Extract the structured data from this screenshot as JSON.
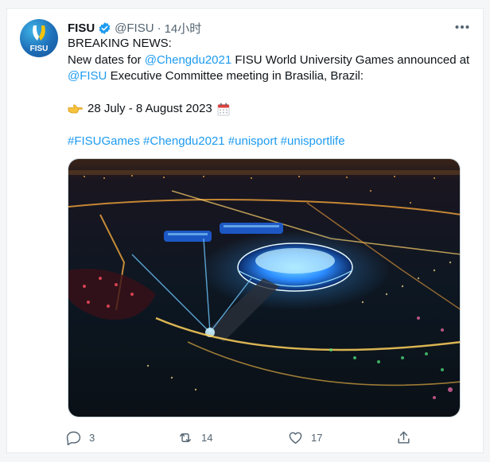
{
  "tweet": {
    "author_name": "FISU",
    "handle": "@FISU",
    "separator": "·",
    "time": "14小时",
    "avatar_text": "FISU",
    "lines": {
      "headline": "BREAKING NEWS:",
      "l2_pre": "New dates for ",
      "l2_mention": "@Chengdu2021",
      "l2_post": " FISU World University Games announced at",
      "l3_mention": "@FISU",
      "l3_post": " Executive Committee meeting in Brasilia, Brazil:",
      "date_text": "28 July - 8 August 2023",
      "hashtags": "#FISUGames #Chengdu2021 #unisport #unisportlife"
    },
    "icons": {
      "verified": "verified-badge-icon",
      "more": "more-options-icon",
      "pointing": "pointing-hand-emoji",
      "calendar": "calendar-emoji"
    },
    "media_alt": "Aerial night view of the illuminated Chengdu stadium",
    "stats": {
      "replies": "3",
      "retweets": "14",
      "likes": "17"
    },
    "colors": {
      "link": "#1d9bf0",
      "text": "#0f1419",
      "muted": "#536471"
    }
  }
}
